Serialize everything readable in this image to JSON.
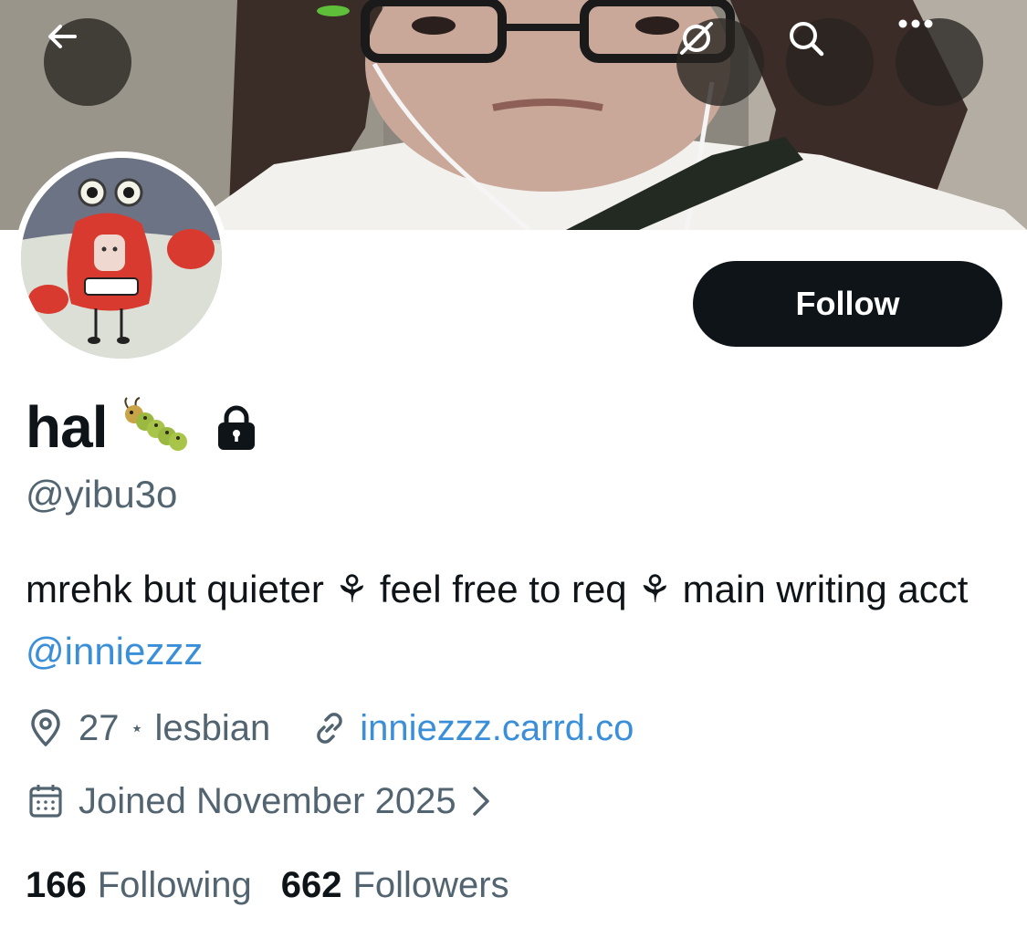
{
  "header": {
    "back_icon": "arrow-left-icon",
    "grok_icon": "grok-icon",
    "search_icon": "search-icon",
    "more_icon": "more-horizontal-icon"
  },
  "profile": {
    "display_name": "hal",
    "name_emoji": "caterpillar-emoji",
    "protected_icon": "lock-icon",
    "handle": "@yibu3o",
    "follow_label": "Follow",
    "bio": {
      "text_1": "mrehk but quieter",
      "sep_1": "⚘",
      "text_2": "feel free to req",
      "sep_2": "⚘",
      "text_3": "main writing acct",
      "mention": "@inniezzz"
    },
    "location": {
      "age": "27",
      "dot": "⋆",
      "identity": "lesbian"
    },
    "website": "inniezzz.carrd.co",
    "joined": "Joined November 2025",
    "following_count": "166",
    "following_label": "Following",
    "followers_count": "662",
    "followers_label": "Followers"
  },
  "colors": {
    "text_primary": "#0f1419",
    "text_secondary": "#536471",
    "link": "#3b8fd9",
    "follow_bg": "#0f1419"
  }
}
